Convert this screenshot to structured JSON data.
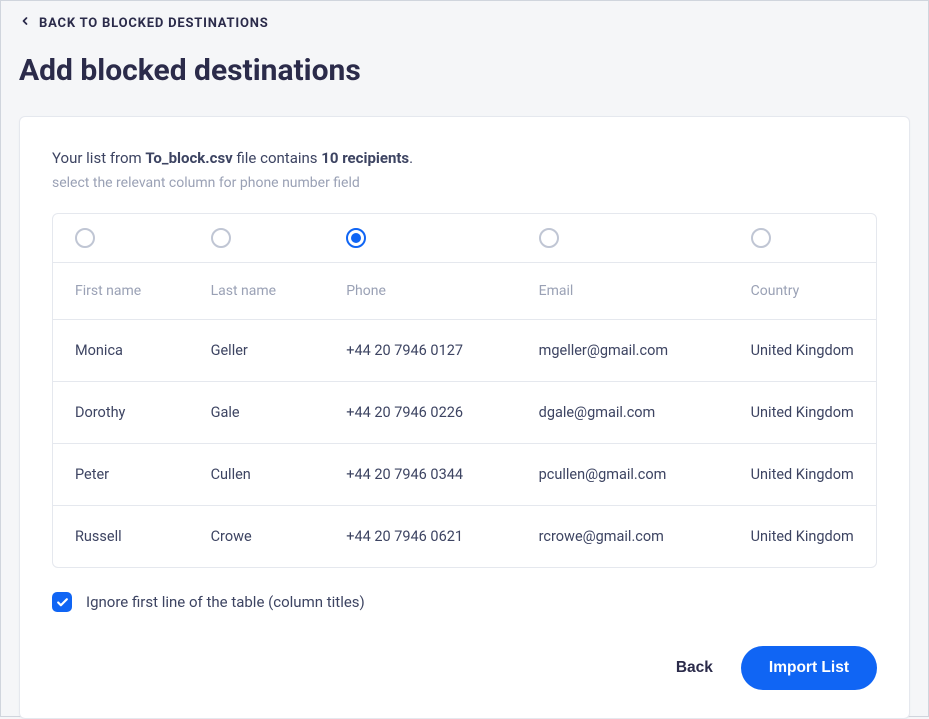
{
  "back_link": "BACK TO BLOCKED DESTINATIONS",
  "page_title": "Add blocked destinations",
  "info_prefix": "Your list from ",
  "info_filename": "To_block.csv",
  "info_middle": " file contains ",
  "info_count": "10 recipients",
  "info_suffix": ".",
  "subtext": "select the relevant column for phone number field",
  "selected_column_index": 2,
  "columns": [
    {
      "label": "First name"
    },
    {
      "label": "Last name"
    },
    {
      "label": "Phone"
    },
    {
      "label": "Email"
    },
    {
      "label": "Country"
    }
  ],
  "rows": [
    {
      "c0": "Monica",
      "c1": "Geller",
      "c2": "+44 20 7946 0127",
      "c3": "mgeller@gmail.com",
      "c4": "United Kingdom"
    },
    {
      "c0": "Dorothy",
      "c1": "Gale",
      "c2": "+44 20 7946 0226",
      "c3": "dgale@gmail.com",
      "c4": "United Kingdom"
    },
    {
      "c0": "Peter",
      "c1": "Cullen",
      "c2": "+44 20 7946 0344",
      "c3": "pcullen@gmail.com",
      "c4": "United Kingdom"
    },
    {
      "c0": "Russell",
      "c1": "Crowe",
      "c2": "+44 20 7946 0621",
      "c3": "rcrowe@gmail.com",
      "c4": "United Kingdom"
    }
  ],
  "ignore_checkbox": {
    "checked": true,
    "label": "Ignore first line of the table (column titles)"
  },
  "buttons": {
    "back": "Back",
    "import": "Import List"
  }
}
